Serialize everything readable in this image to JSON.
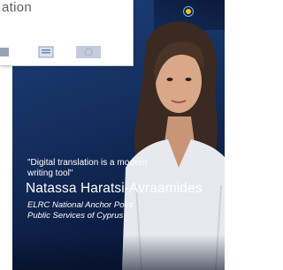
{
  "back_slide": {
    "title_fragment": "ation"
  },
  "video": {
    "quote": "\"Digital translation is a modern writing tool\"",
    "name": "Natassa Haratsi-Avraamides",
    "role_line_1": "ELRC National Anchor Point",
    "role_line_2": "Public Services of Cyprus"
  },
  "colors": {
    "card_blue": "#163264",
    "card_dark": "#08142f",
    "text_white": "#ffffff",
    "back_title_gray": "#5a5e66"
  }
}
